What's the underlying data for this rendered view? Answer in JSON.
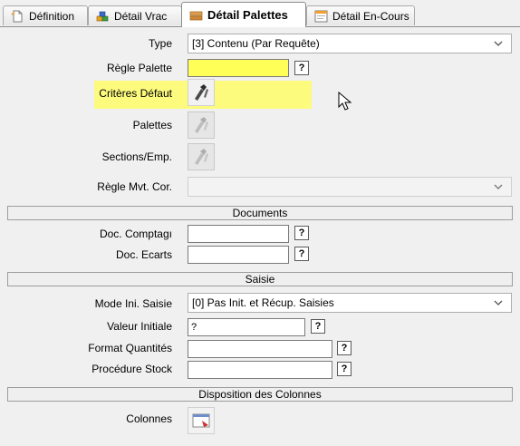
{
  "tabs": [
    {
      "label": "Définition",
      "icon": "page-icon"
    },
    {
      "label": "Détail Vrac",
      "icon": "bricks-icon"
    },
    {
      "label": "Détail Palettes",
      "icon": "pallet-icon",
      "active": true
    },
    {
      "label": "Détail En-Cours",
      "icon": "window-icon"
    }
  ],
  "fields": {
    "type": {
      "label": "Type",
      "value": "[3] Contenu (Par Requête)"
    },
    "regle_palette": {
      "label": "Règle Palette",
      "value": "",
      "help": "?"
    },
    "criteres_defaut": {
      "label": "Critères Défaut"
    },
    "palettes": {
      "label": "Palettes"
    },
    "sections_emp": {
      "label": "Sections/Emp."
    },
    "regle_mvt_cor": {
      "label": "Règle Mvt. Cor.",
      "value": ""
    }
  },
  "sections": {
    "documents": "Documents",
    "saisie": "Saisie",
    "disposition": "Disposition des Colonnes"
  },
  "documents": {
    "doc_comptage": {
      "label": "Doc. Comptagı",
      "value": "",
      "help": "?"
    },
    "doc_ecarts": {
      "label": "Doc. Ecarts",
      "value": "",
      "help": "?"
    }
  },
  "saisie": {
    "mode_ini": {
      "label": "Mode Ini. Saisie",
      "value": "[0] Pas Init. et Récup. Saisies"
    },
    "valeur_initiale": {
      "label": "Valeur Initiale",
      "value": "?",
      "help": "?"
    },
    "format_quantites": {
      "label": "Format Quantités",
      "value": "",
      "help": "?"
    },
    "procedure_stock": {
      "label": "Procédure Stock",
      "value": "",
      "help": "?"
    }
  },
  "disposition": {
    "colonnes": {
      "label": "Colonnes"
    }
  },
  "colors": {
    "highlight": "#fdfb7e",
    "active_input": "#ffff58",
    "panel": "#f0f0f0"
  }
}
